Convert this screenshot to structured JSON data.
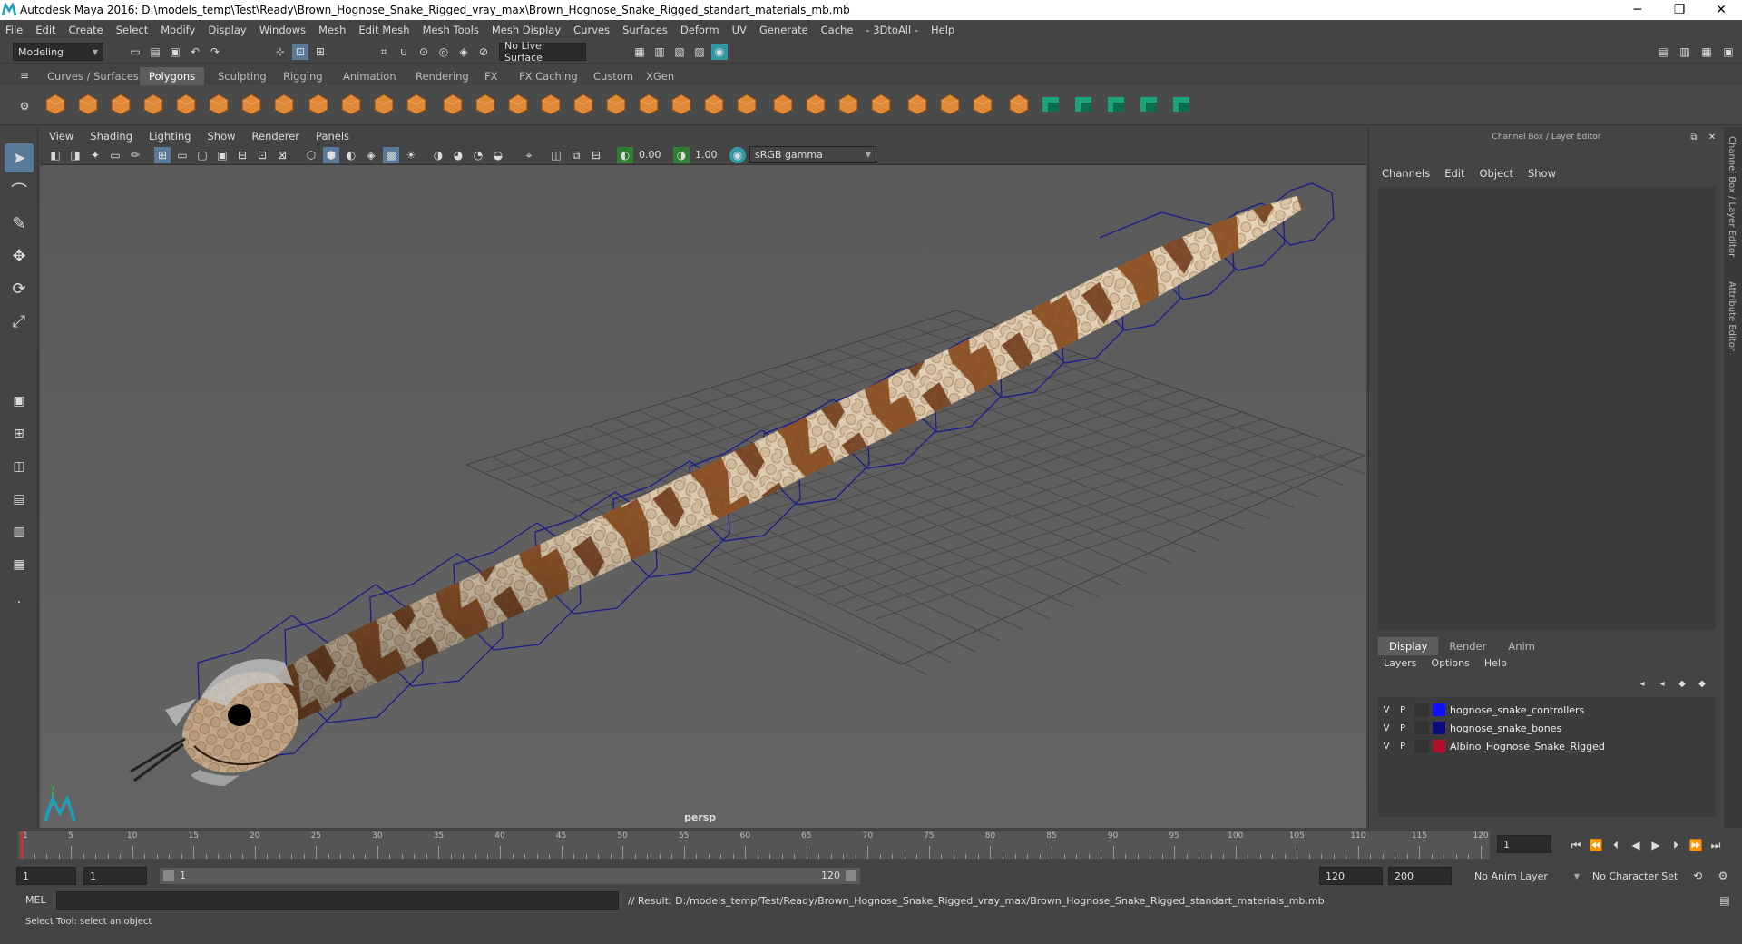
{
  "window": {
    "title": "Autodesk Maya 2016: D:\\models_temp\\Test\\Ready\\Brown_Hognose_Snake_Rigged_vray_max\\Brown_Hognose_Snake_Rigged_standart_materials_mb.mb"
  },
  "menubar": [
    "File",
    "Edit",
    "Create",
    "Select",
    "Modify",
    "Display",
    "Windows",
    "Mesh",
    "Edit Mesh",
    "Mesh Tools",
    "Mesh Display",
    "Curves",
    "Surfaces",
    "Deform",
    "UV",
    "Generate",
    "Cache",
    "- 3DtoAll -",
    "Help"
  ],
  "statusline": {
    "mode": "Modeling",
    "live_surface": "No Live Surface"
  },
  "shelf": {
    "tabs": [
      "Curves / Surfaces",
      "Polygons",
      "Sculpting",
      "Rigging",
      "Animation",
      "Rendering",
      "FX",
      "FX Caching",
      "Custom",
      "XGen"
    ],
    "active_tab": "Polygons"
  },
  "viewport": {
    "menu": [
      "View",
      "Shading",
      "Lighting",
      "Show",
      "Renderer",
      "Panels"
    ],
    "exposure": "0.00",
    "gamma": "1.00",
    "color_space": "sRGB gamma",
    "camera_label": "persp"
  },
  "channel_box": {
    "title": "Channel Box / Layer Editor",
    "menu": [
      "Channels",
      "Edit",
      "Object",
      "Show"
    ],
    "layer_tabs": [
      "Display",
      "Render",
      "Anim"
    ],
    "active_layer_tab": "Display",
    "layer_menu": [
      "Layers",
      "Options",
      "Help"
    ],
    "layers": [
      {
        "v": "V",
        "p": "P",
        "color": "#1010ff",
        "name": "hognose_snake_controllers"
      },
      {
        "v": "V",
        "p": "P",
        "color": "#0a0a80",
        "name": "hognose_snake_bones"
      },
      {
        "v": "V",
        "p": "P",
        "color": "#b0102a",
        "name": "Albino_Hognose_Snake_Rigged"
      }
    ],
    "side_tabs": [
      "Channel Box / Layer Editor",
      "Attribute Editor"
    ]
  },
  "timeslider": {
    "ticks": [
      "1",
      "5",
      "10",
      "15",
      "20",
      "25",
      "30",
      "35",
      "40",
      "45",
      "50",
      "55",
      "60",
      "65",
      "70",
      "75",
      "80",
      "85",
      "90",
      "95",
      "100",
      "105",
      "110",
      "115",
      "120"
    ],
    "current_frame": "1"
  },
  "range": {
    "start": "1",
    "playback_start": "1",
    "range_start_label": "1",
    "range_end_label": "120",
    "playback_end": "120",
    "end": "200",
    "anim_layer": "No Anim Layer",
    "character_set": "No Character Set"
  },
  "command": {
    "lang": "MEL",
    "result": "// Result: D:/models_temp/Test/Ready/Brown_Hognose_Snake_Rigged_vray_max/Brown_Hognose_Snake_Rigged_standart_materials_mb.mb"
  },
  "helpline": "Select Tool: select an object"
}
